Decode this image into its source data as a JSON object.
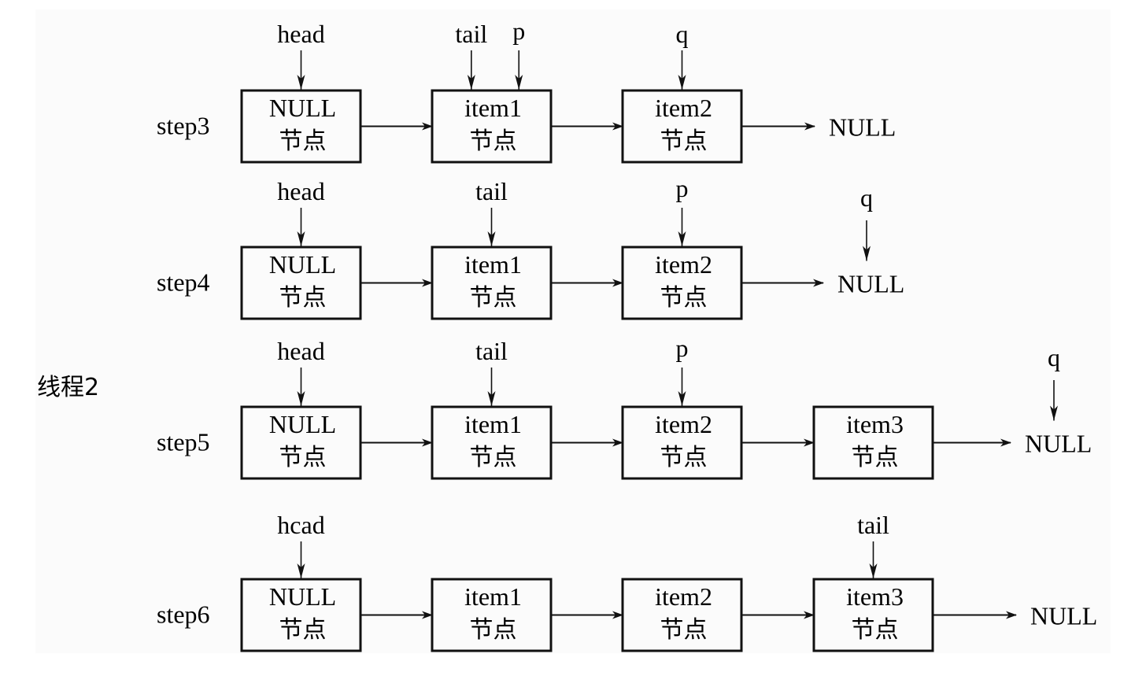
{
  "thread_label": "线程2",
  "colors": {
    "ink": "#111111",
    "background": "#fbfbfb"
  },
  "steps": [
    {
      "label": "step3",
      "nodes": [
        {
          "value": "NULL",
          "sub": "节点",
          "pointers": [
            "head"
          ]
        },
        {
          "value": "item1",
          "sub": "节点",
          "pointers": [
            "tail",
            "p"
          ]
        },
        {
          "value": "item2",
          "sub": "节点",
          "pointers": [
            "q"
          ]
        }
      ],
      "terminal": {
        "text": "NULL",
        "pointers": []
      }
    },
    {
      "label": "step4",
      "nodes": [
        {
          "value": "NULL",
          "sub": "节点",
          "pointers": [
            "head"
          ]
        },
        {
          "value": "item1",
          "sub": "节点",
          "pointers": [
            "tail"
          ]
        },
        {
          "value": "item2",
          "sub": "节点",
          "pointers": [
            "p"
          ]
        }
      ],
      "terminal": {
        "text": "NULL",
        "pointers": [
          "q"
        ]
      }
    },
    {
      "label": "step5",
      "nodes": [
        {
          "value": "NULL",
          "sub": "节点",
          "pointers": [
            "head"
          ]
        },
        {
          "value": "item1",
          "sub": "节点",
          "pointers": [
            "tail"
          ]
        },
        {
          "value": "item2",
          "sub": "节点",
          "pointers": [
            "p"
          ]
        },
        {
          "value": "item3",
          "sub": "节点",
          "pointers": []
        }
      ],
      "terminal": {
        "text": "NULL",
        "pointers": [
          "q"
        ]
      }
    },
    {
      "label": "step6",
      "nodes": [
        {
          "value": "NULL",
          "sub": "节点",
          "pointers": [
            "hcad"
          ]
        },
        {
          "value": "item1",
          "sub": "节点",
          "pointers": []
        },
        {
          "value": "item2",
          "sub": "节点",
          "pointers": []
        },
        {
          "value": "item3",
          "sub": "节点",
          "pointers": [
            "tail"
          ]
        }
      ],
      "terminal": {
        "text": "NULL",
        "pointers": []
      }
    }
  ]
}
